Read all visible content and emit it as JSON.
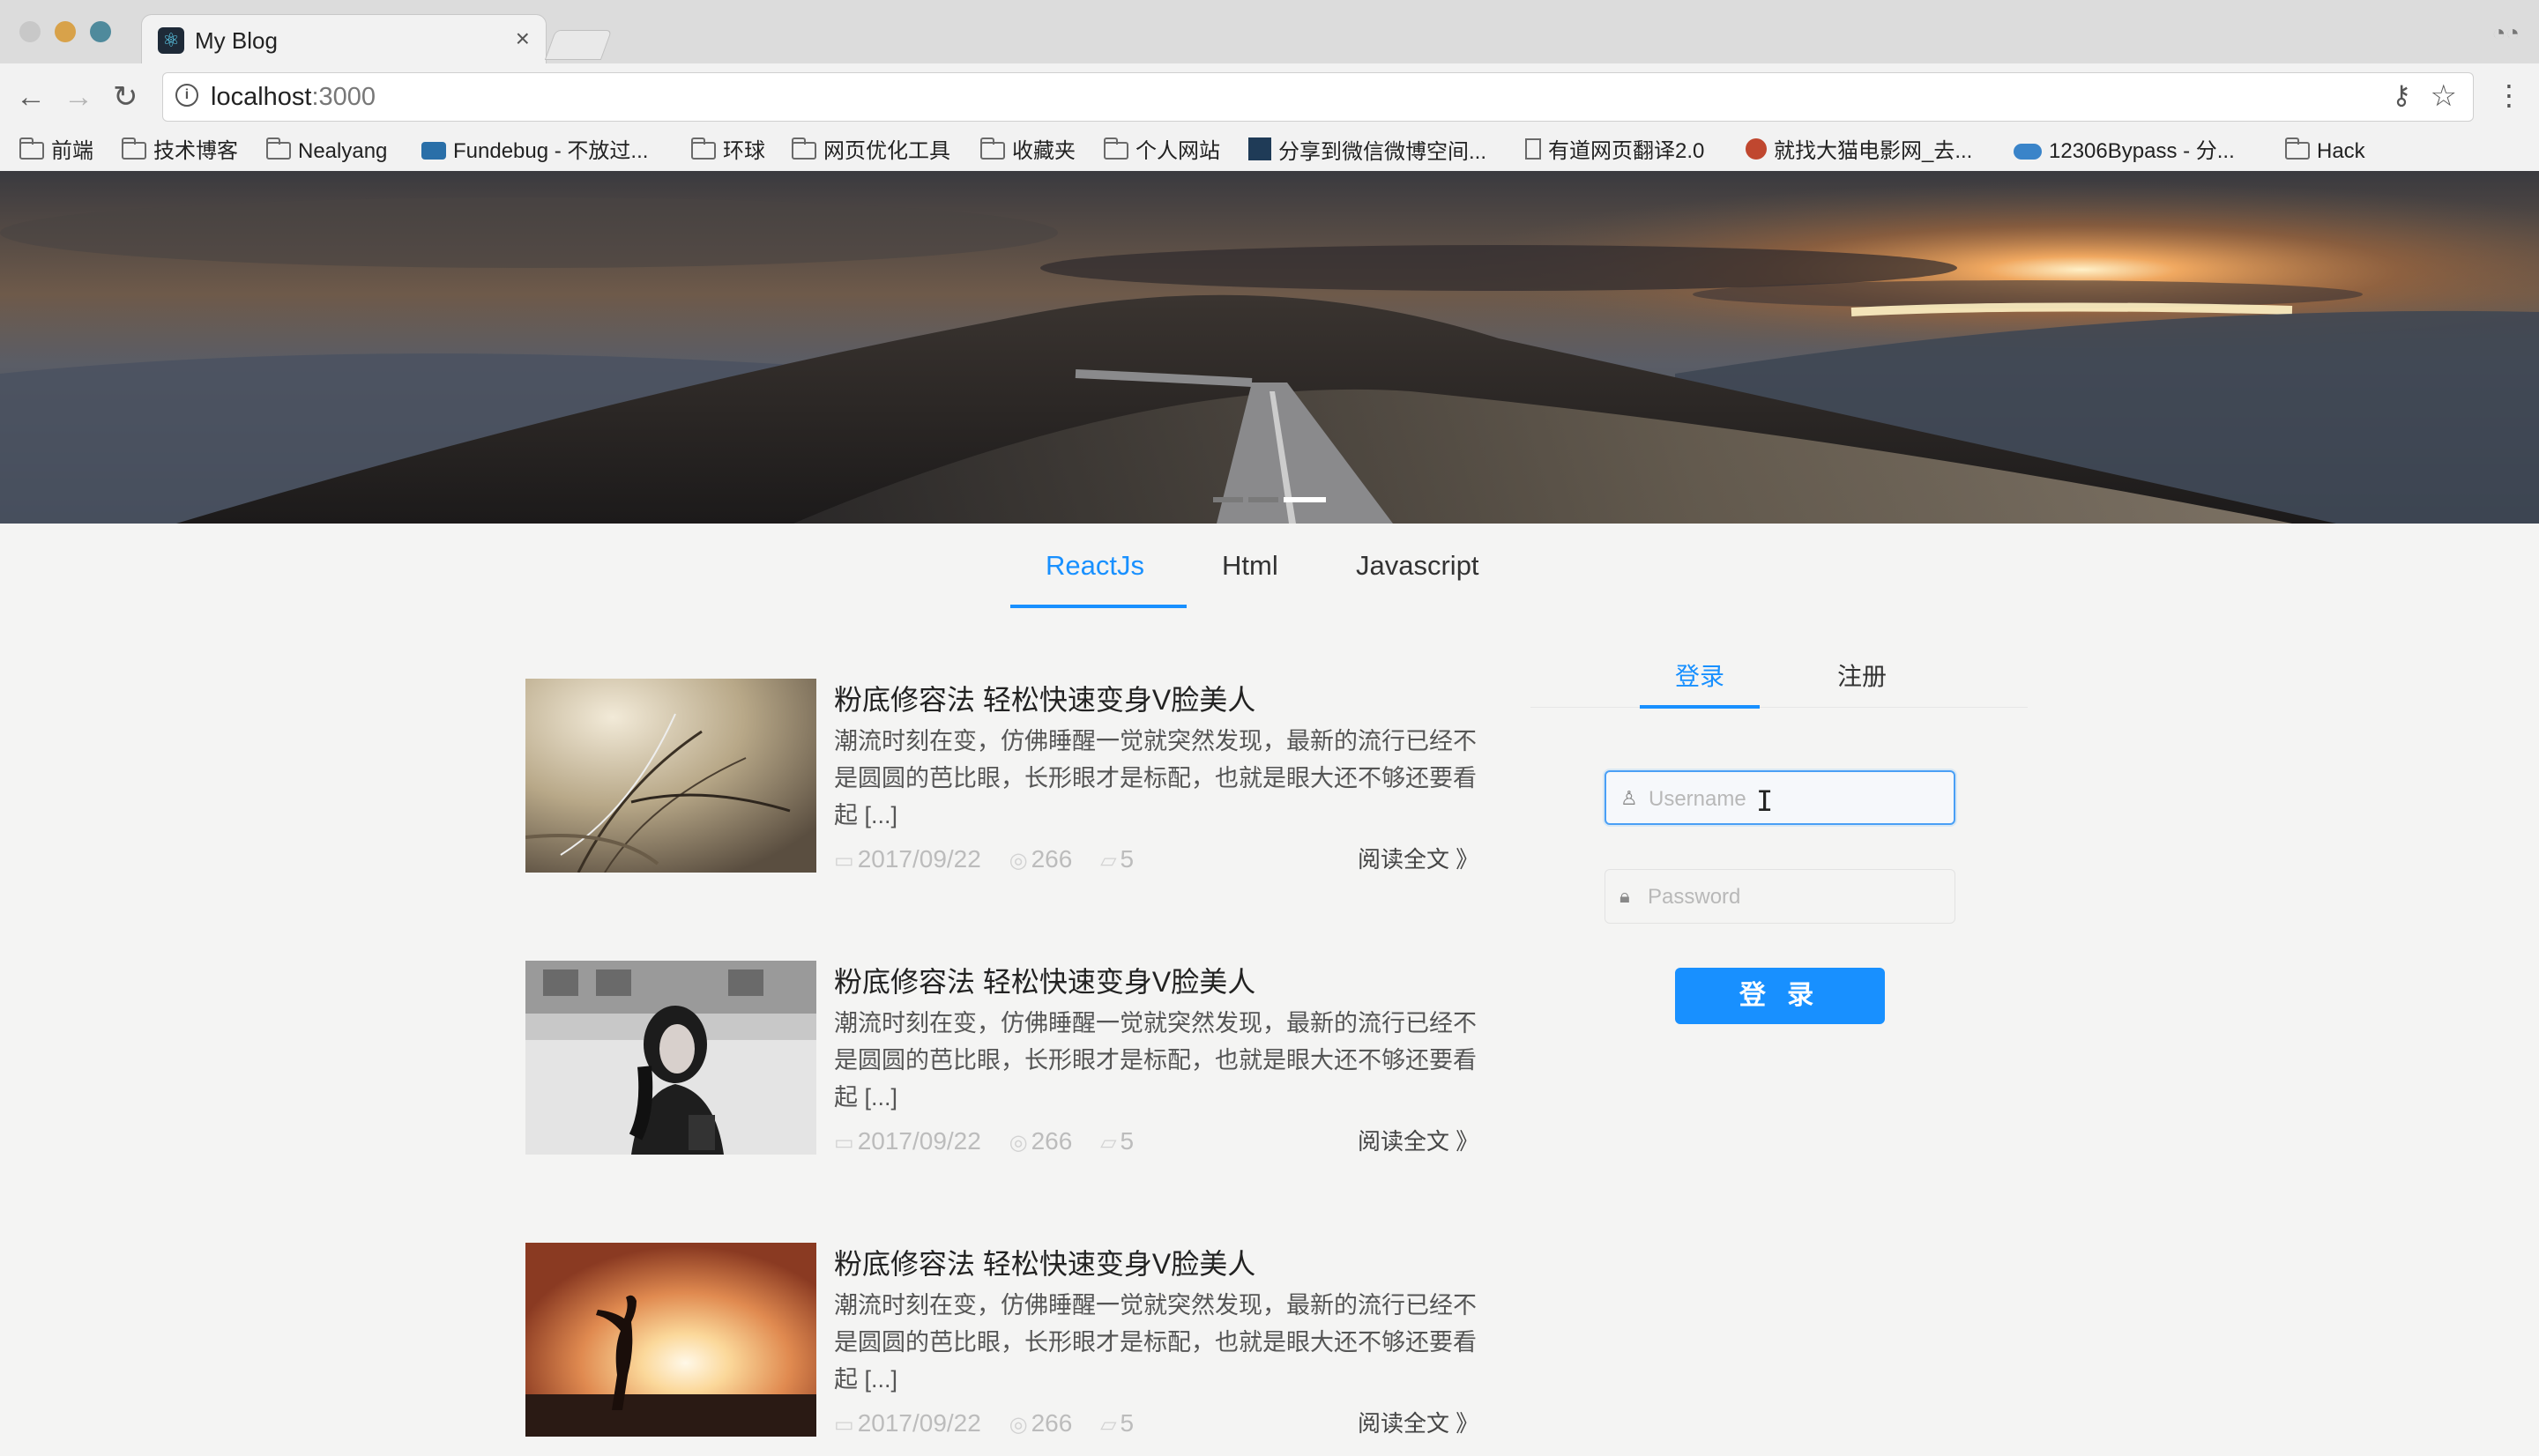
{
  "browser": {
    "tab_title": "My Blog",
    "tab_close": "×",
    "url_host": "localhost",
    "url_port": ":3000",
    "bookmarks": [
      {
        "label": "前端",
        "icon": "folder-icon"
      },
      {
        "label": "技术博客",
        "icon": "folder-icon"
      },
      {
        "label": "Nealyang",
        "icon": "folder-icon"
      },
      {
        "label": "Fundebug - 不放过...",
        "icon": "fundebug-icon"
      },
      {
        "label": "环球",
        "icon": "folder-icon"
      },
      {
        "label": "网页优化工具",
        "icon": "folder-icon"
      },
      {
        "label": "收藏夹",
        "icon": "folder-icon"
      },
      {
        "label": "个人网站",
        "icon": "folder-icon"
      },
      {
        "label": "分享到微信微博空间...",
        "icon": "share-icon"
      },
      {
        "label": "有道网页翻译2.0",
        "icon": "document-icon"
      },
      {
        "label": "就找大猫电影网_去...",
        "icon": "cat-icon"
      },
      {
        "label": "12306Bypass - 分...",
        "icon": "cloud-icon"
      },
      {
        "label": "Hack",
        "icon": "folder-icon"
      }
    ]
  },
  "nav": {
    "tabs": [
      "ReactJs",
      "Html",
      "Javascript"
    ],
    "active": "ReactJs"
  },
  "posts": [
    {
      "title": "粉底修容法 轻松快速变身V脸美人",
      "excerpt": "潮流时刻在变，仿佛睡醒一觉就突然发现，最新的流行已经不是圆圆的芭比眼，长形眼才是标配，也就是眼大还不够还要看起 [...]",
      "date": "2017/09/22",
      "views": "266",
      "comments": "5",
      "read_more": "阅读全文 》"
    },
    {
      "title": "粉底修容法 轻松快速变身V脸美人",
      "excerpt": "潮流时刻在变，仿佛睡醒一觉就突然发现，最新的流行已经不是圆圆的芭比眼，长形眼才是标配，也就是眼大还不够还要看起 [...]",
      "date": "2017/09/22",
      "views": "266",
      "comments": "5",
      "read_more": "阅读全文 》"
    },
    {
      "title": "粉底修容法 轻松快速变身V脸美人",
      "excerpt": "潮流时刻在变，仿佛睡醒一觉就突然发现，最新的流行已经不是圆圆的芭比眼，长形眼才是标配，也就是眼大还不够还要看起 [...]",
      "date": "2017/09/22",
      "views": "266",
      "comments": "5",
      "read_more": "阅读全文 》"
    }
  ],
  "auth": {
    "login_tab": "登录",
    "register_tab": "注册",
    "username_placeholder": "Username",
    "password_placeholder": "Password",
    "submit": "登 录"
  },
  "colors": {
    "accent": "#1890ff",
    "page_bg": "#f4f4f3"
  }
}
